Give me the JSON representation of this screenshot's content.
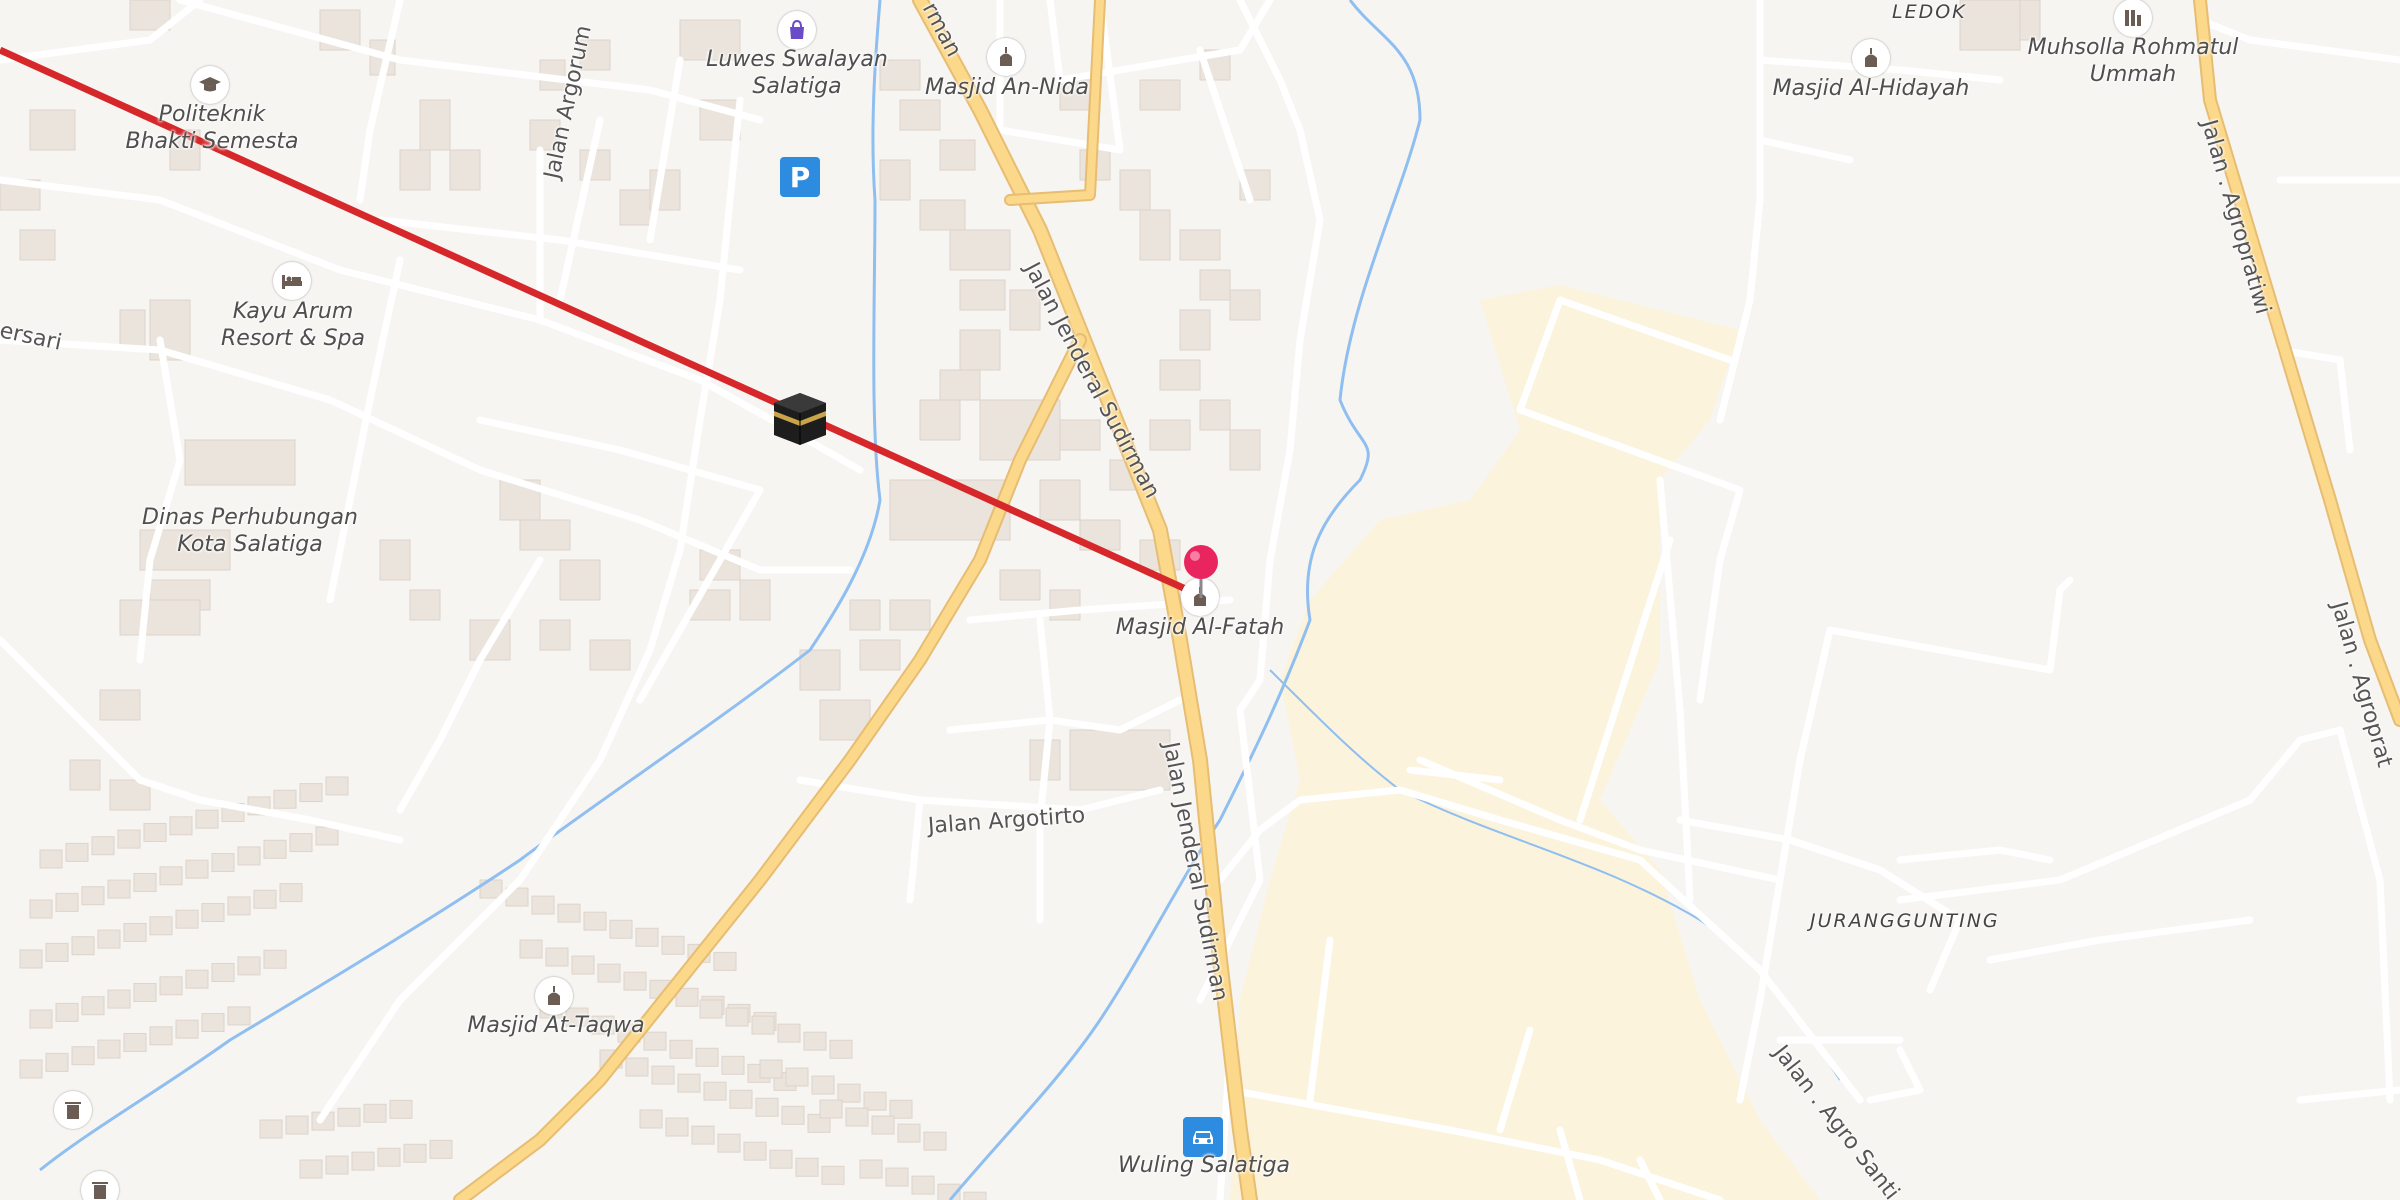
{
  "map": {
    "places": [
      {
        "name": "Politeknik\nBhakti Semesta",
        "icon": "graduation-cap-icon"
      },
      {
        "name": "Luwes Swalayan\nSalatiga",
        "icon": "shopping-bag-icon"
      },
      {
        "name": "Masjid An-Nida",
        "icon": "mosque-icon"
      },
      {
        "name": "Kayu Arum\nResort & Spa",
        "icon": "bed-icon"
      },
      {
        "name": "Dinas Perhubungan\nKota Salatiga",
        "icon": ""
      },
      {
        "name": "Masjid Al-Fatah",
        "icon": "mosque-icon"
      },
      {
        "name": "Masjid At-Taqwa",
        "icon": "mosque-icon"
      },
      {
        "name": "Wuling Salatiga",
        "icon": "car-dealer-icon"
      },
      {
        "name": "Masjid Al-Hidayah",
        "icon": "mosque-icon"
      },
      {
        "name": "Muhsolla Rohmatul\nUmmah",
        "icon": "prayer-room-icon"
      }
    ],
    "areas": [
      "LEDOK",
      "JURANGGUNTING"
    ],
    "streets": {
      "sudirman_top": "Jalan Jenderal Sudirman",
      "sudirman_bottom": "Jalan Jenderal Sudirman",
      "sudirman_fragment": "rman",
      "argorum": "Jalan Argorum",
      "argotirto": "Jalan Argotirto",
      "agropratiwi_top": "Jalan . Agropratiwi",
      "agropratiwi_right": "Jalan . Agroprat",
      "agro_santi": "Jalan . Agro Santi",
      "left_fragment": "ersari"
    },
    "parking_label": "P",
    "kaaba_icon": "kaaba-icon",
    "pin_icon": "map-pin-icon",
    "colors": {
      "background": "#f7f5f2",
      "qibla_line": "#d6282b",
      "primary_road": "#fbd88a",
      "water": "#8fbef0",
      "farmland": "#fbf3dc",
      "pin": "#e8255e",
      "poi_blue": "#2d8be0"
    }
  }
}
